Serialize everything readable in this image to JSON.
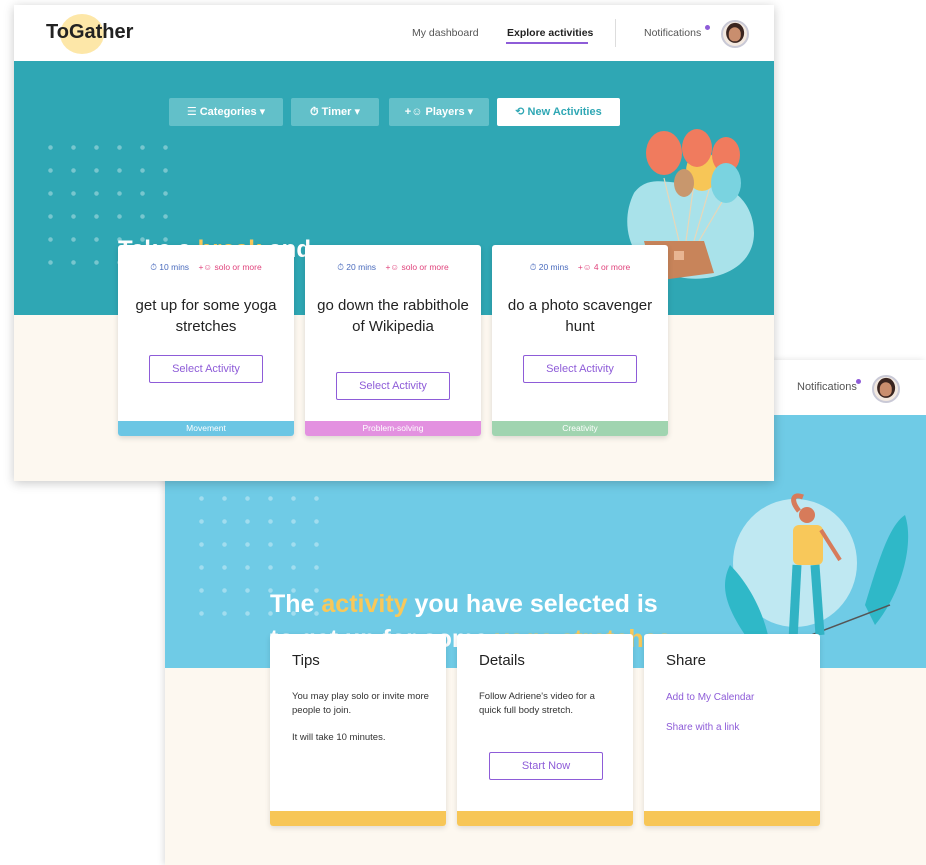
{
  "brand": {
    "name": "ToGather"
  },
  "colors": {
    "purple": "#8e5cd8",
    "teal": "#2fa7b4",
    "light_blue": "#6fcbe6",
    "yellow": "#f7c657",
    "cream": "#fdf8f0",
    "movement": "#6cc6e4",
    "problem_solving": "#e391e0",
    "creativity": "#a0d4b0"
  },
  "front": {
    "nav": {
      "dashboard": "My dashboard",
      "explore": "Explore activities",
      "notifications": "Notifications"
    },
    "filters": {
      "categories": "Categories ▾",
      "timer": "Timer ▾",
      "players": "Players ▾",
      "new_activities": "New Activities"
    },
    "headline": {
      "pre": "Take a ",
      "highlight": "break",
      "post": " and..."
    },
    "cards": [
      {
        "time": "10 mins",
        "players": "solo or more",
        "title": "get up for some yoga stretches",
        "button": "Select Activity",
        "category": "Movement"
      },
      {
        "time": "20 mins",
        "players": "solo or more",
        "title": "go down the rabbithole of Wikipedia",
        "button": "Select Activity",
        "category": "Problem-solving"
      },
      {
        "time": "20 mins",
        "players": "4 or more",
        "title": "do a photo scavenger hunt",
        "button": "Select Activity",
        "category": "Creativity"
      }
    ]
  },
  "back": {
    "nav": {
      "notifications": "Notifications"
    },
    "headline": {
      "l1_pre": "The ",
      "l1_hl": "activity",
      "l1_post": " you have selected is",
      "l2_pre": "to get up for some ",
      "l2_hl": "yoga stretches",
      "l2_post": "."
    },
    "tips": {
      "title": "Tips",
      "text1": "You may play solo or invite more people to join.",
      "text2": "It will take 10 minutes."
    },
    "details": {
      "title": "Details",
      "text": "Follow Adriene's video for a quick full body stretch.",
      "button": "Start Now"
    },
    "share": {
      "title": "Share",
      "link1": "Add to My Calendar",
      "link2": "Share with a link"
    }
  }
}
